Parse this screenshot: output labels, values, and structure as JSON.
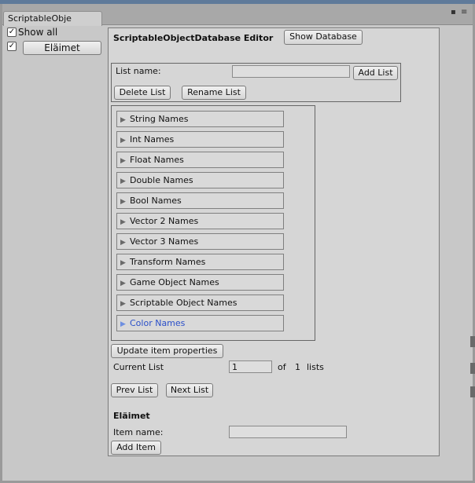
{
  "window": {
    "tab_title": "ScriptableObje",
    "controls": {
      "minimize": "▪",
      "menu": "≡"
    }
  },
  "sidebar": {
    "show_all_label": "Show all",
    "show_all_checked": "✓",
    "item_checked": "✓",
    "item_button": "Eläimet"
  },
  "editor": {
    "title": "ScriptableObjectDatabase Editor",
    "show_database_button": "Show Database",
    "list_name_label": "List name:",
    "list_name_value": "",
    "add_list_button": "Add List",
    "delete_list_button": "Delete List",
    "rename_list_button": "Rename List",
    "foldouts": [
      {
        "label": "String Names"
      },
      {
        "label": "Int Names"
      },
      {
        "label": "Float Names"
      },
      {
        "label": "Double Names"
      },
      {
        "label": "Bool Names"
      },
      {
        "label": "Vector 2 Names"
      },
      {
        "label": "Vector 3 Names"
      },
      {
        "label": "Transform Names"
      },
      {
        "label": "Game Object Names"
      },
      {
        "label": "Scriptable Object Names"
      },
      {
        "label": "Color Names"
      }
    ],
    "foldout_arrow": "▶",
    "update_button": "Update item properties",
    "current_list_label": "Current List",
    "current_list_value": "1",
    "of_label": "of",
    "total_lists": "1",
    "lists_label": "lists",
    "prev_button": "Prev List",
    "next_button": "Next List",
    "section_title": "Eläimet",
    "item_name_label": "Item name:",
    "item_name_value": "",
    "add_item_button": "Add Item"
  },
  "colors": {
    "active_foldout": "#2a4fc9",
    "panel_bg": "#d6d6d6",
    "window_bg": "#c8c8c8"
  }
}
